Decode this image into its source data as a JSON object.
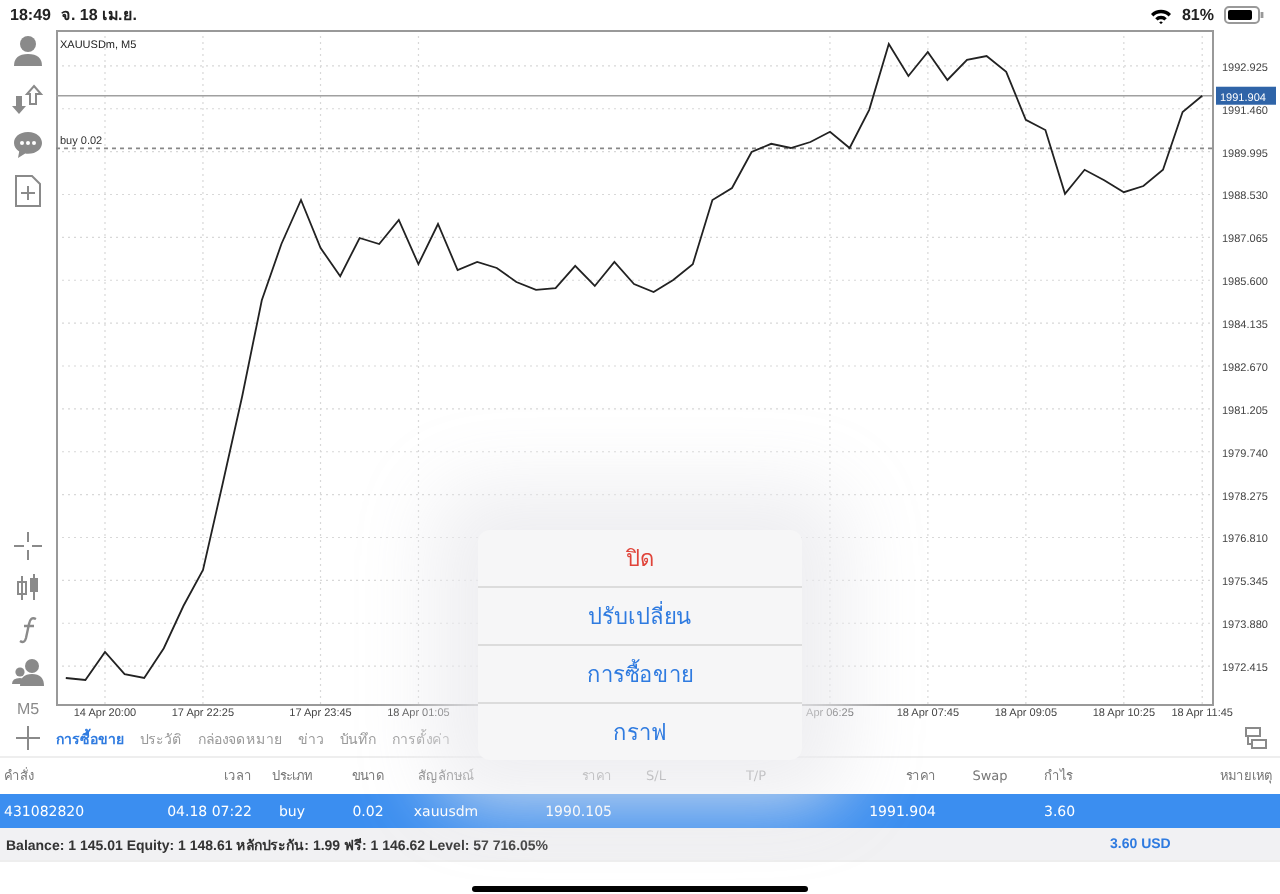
{
  "status_bar": {
    "time": "18:49",
    "date": "จ. 18 เม.ย.",
    "battery": "81%"
  },
  "sidebar": {
    "timeframe": "M5"
  },
  "chart": {
    "chart_data": {
      "type": "line",
      "title": "XAUUSDm, M5",
      "grid": true,
      "ylim": [
        1971.12,
        1994.15
      ],
      "categories": [
        null,
        null,
        "14 Apr 20:00",
        null,
        null,
        null,
        null,
        "17 Apr 22:25",
        null,
        null,
        null,
        null,
        null,
        "17 Apr 23:45",
        null,
        null,
        null,
        null,
        "18 Apr 01:05",
        null,
        null,
        null,
        null,
        null,
        null,
        null,
        null,
        null,
        null,
        null,
        null,
        null,
        null,
        null,
        null,
        null,
        null,
        null,
        null,
        "Apr 06:25",
        null,
        null,
        null,
        null,
        "18 Apr 07:45",
        null,
        null,
        null,
        null,
        "18 Apr 09:05",
        null,
        null,
        null,
        null,
        "18 Apr 10:25",
        null,
        null,
        null,
        "18 Apr 11:45"
      ],
      "yticks": [
        {
          "value": 1972.415,
          "label": "1972.415"
        },
        {
          "value": 1973.88,
          "label": "1973.880"
        },
        {
          "value": 1975.345,
          "label": "1975.345"
        },
        {
          "value": 1976.81,
          "label": "1976.810"
        },
        {
          "value": 1978.275,
          "label": "1978.275"
        },
        {
          "value": 1979.74,
          "label": "1979.740"
        },
        {
          "value": 1981.205,
          "label": "1981.205"
        },
        {
          "value": 1982.67,
          "label": "1982.670"
        },
        {
          "value": 1984.135,
          "label": "1984.135"
        },
        {
          "value": 1985.6,
          "label": "1985.600"
        },
        {
          "value": 1987.065,
          "label": "1987.065"
        },
        {
          "value": 1988.53,
          "label": "1988.530"
        },
        {
          "value": 1989.995,
          "label": "1989.995"
        },
        {
          "value": 1991.46,
          "label": "1991.460"
        },
        {
          "value": 1992.925,
          "label": "1992.925"
        }
      ],
      "series": [
        {
          "color": "#222222",
          "values": [
            1972.01,
            1971.94,
            1972.9,
            1972.14,
            1972.01,
            1973.03,
            1974.47,
            1975.7,
            1978.64,
            1981.64,
            1984.92,
            1986.84,
            1988.34,
            1986.7,
            1985.74,
            1987.04,
            1986.84,
            1987.66,
            1986.15,
            1987.52,
            1985.95,
            1986.22,
            1986.02,
            1985.54,
            1985.27,
            1985.33,
            1986.09,
            1985.4,
            1986.22,
            1985.47,
            1985.2,
            1985.61,
            1986.15,
            1988.34,
            1988.75,
            1989.98,
            1990.26,
            1990.12,
            1990.32,
            1990.67,
            1990.12,
            1991.42,
            1993.67,
            1992.58,
            1993.4,
            1992.44,
            1993.13,
            1993.26,
            1992.72,
            1991.08,
            1990.73,
            1988.55,
            1989.37,
            1989.02,
            1988.61,
            1988.82,
            1989.37,
            1991.35,
            1991.9
          ]
        }
      ],
      "ref_lines": [
        {
          "axis": "y",
          "value": 1991.904,
          "label": "1991.904"
        },
        {
          "axis": "y",
          "value": 1990.105,
          "label": "buy 0.02"
        }
      ]
    }
  },
  "tabs": [
    {
      "label": "การซื้อขาย",
      "selected": true
    },
    {
      "label": "ประวัติ",
      "selected": false
    },
    {
      "label": "กล่องจดหมาย",
      "selected": false
    },
    {
      "label": "ข่าว",
      "selected": false
    },
    {
      "label": "บันทึก",
      "selected": false
    },
    {
      "label": "การตั้งค่า",
      "selected": false
    }
  ],
  "table": {
    "columns": [
      "คำสั่ง",
      "เวลา",
      "ประเภท",
      "ขนาด",
      "สัญลักษณ์",
      "ราคา",
      "S/L",
      "T/P",
      "ราคา",
      "Swap",
      "กำไร",
      "หมายเหตุ"
    ],
    "rows": [
      {
        "selected": true,
        "cells": [
          "431082820",
          "04.18 07:22",
          "buy",
          "0.02",
          "xauusdm",
          "1990.105",
          "",
          "",
          "1991.904",
          "",
          "3.60",
          ""
        ]
      }
    ]
  },
  "summary": {
    "text": "Balance: 1 145.01 Equity: 1 148.61 หลักประกัน: 1.99 ฟรี: 1 146.62 Level: 57 716.05%",
    "profit": "3.60  USD"
  },
  "context_menu": {
    "items": [
      {
        "label": "ปิด",
        "kind": "destructive"
      },
      {
        "label": "ปรับเปลี่ยน",
        "kind": "normal"
      },
      {
        "label": "การซื้อขาย",
        "kind": "normal"
      },
      {
        "label": "กราฟ",
        "kind": "normal"
      }
    ]
  }
}
